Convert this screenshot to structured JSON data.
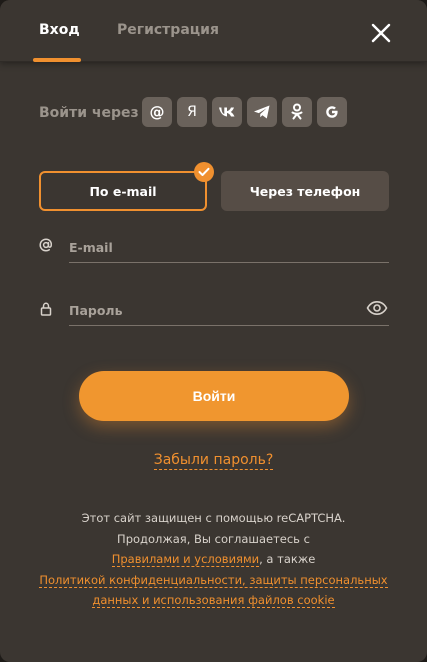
{
  "tabs": {
    "login": "Вход",
    "register": "Регистрация"
  },
  "social": {
    "label": "Войти через",
    "providers": [
      {
        "name": "mail-ru",
        "glyph": "@"
      },
      {
        "name": "yandex",
        "glyph": "Я"
      },
      {
        "name": "vk",
        "glyph": "VK"
      },
      {
        "name": "telegram",
        "glyph": "telegram-icon"
      },
      {
        "name": "odnoklassniki",
        "glyph": "ok-icon"
      },
      {
        "name": "google",
        "glyph": "G"
      }
    ]
  },
  "methods": {
    "email": "По e-mail",
    "phone": "Через телефон",
    "selected": "email"
  },
  "fields": {
    "email_placeholder": "E-mail",
    "email_value": "",
    "password_placeholder": "Пароль",
    "password_value": ""
  },
  "actions": {
    "submit": "Войти",
    "forgot": "Забыли пароль?"
  },
  "legal": {
    "line1": "Этот сайт защищен с помощью reCAPTCHA.",
    "line2": "Продолжая, Вы соглашаетесь с",
    "terms_link": "Правилами и условиями",
    "line3_suffix": ", а также",
    "privacy_link_line1": "Политикой конфиденциальности, защиты персональных",
    "privacy_link_line2": "данных и использования файлов cookie"
  },
  "colors": {
    "accent": "#f0902f",
    "background": "#3b3631",
    "social_button": "#6a625b"
  }
}
